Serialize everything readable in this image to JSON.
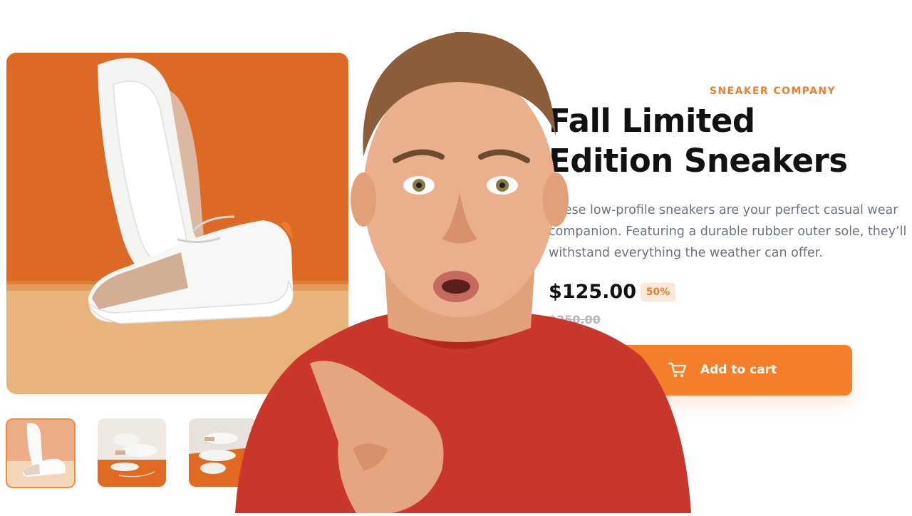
{
  "product": {
    "company": "SNEAKER COMPANY",
    "title": "Fall Limited Edition Sneakers",
    "description": "These low-profile sneakers are your perfect casual wear companion. Featuring a durable rubber outer sole, they’ll withstand everything the weather can offer.",
    "price": "$125.00",
    "discount": "50%",
    "original_price": "$250.00",
    "add_to_cart_label": "Add to cart"
  },
  "gallery": {
    "selected_index": 0,
    "thumbnails": [
      "thumbnail-1",
      "thumbnail-2",
      "thumbnail-3"
    ]
  },
  "icons": {
    "cart": "cart-icon"
  },
  "colors": {
    "accent": "#f47e2a",
    "accent_pale": "#fde8d8",
    "title": "#111111",
    "body_text": "#6b7280",
    "muted": "#b4b8bf"
  }
}
